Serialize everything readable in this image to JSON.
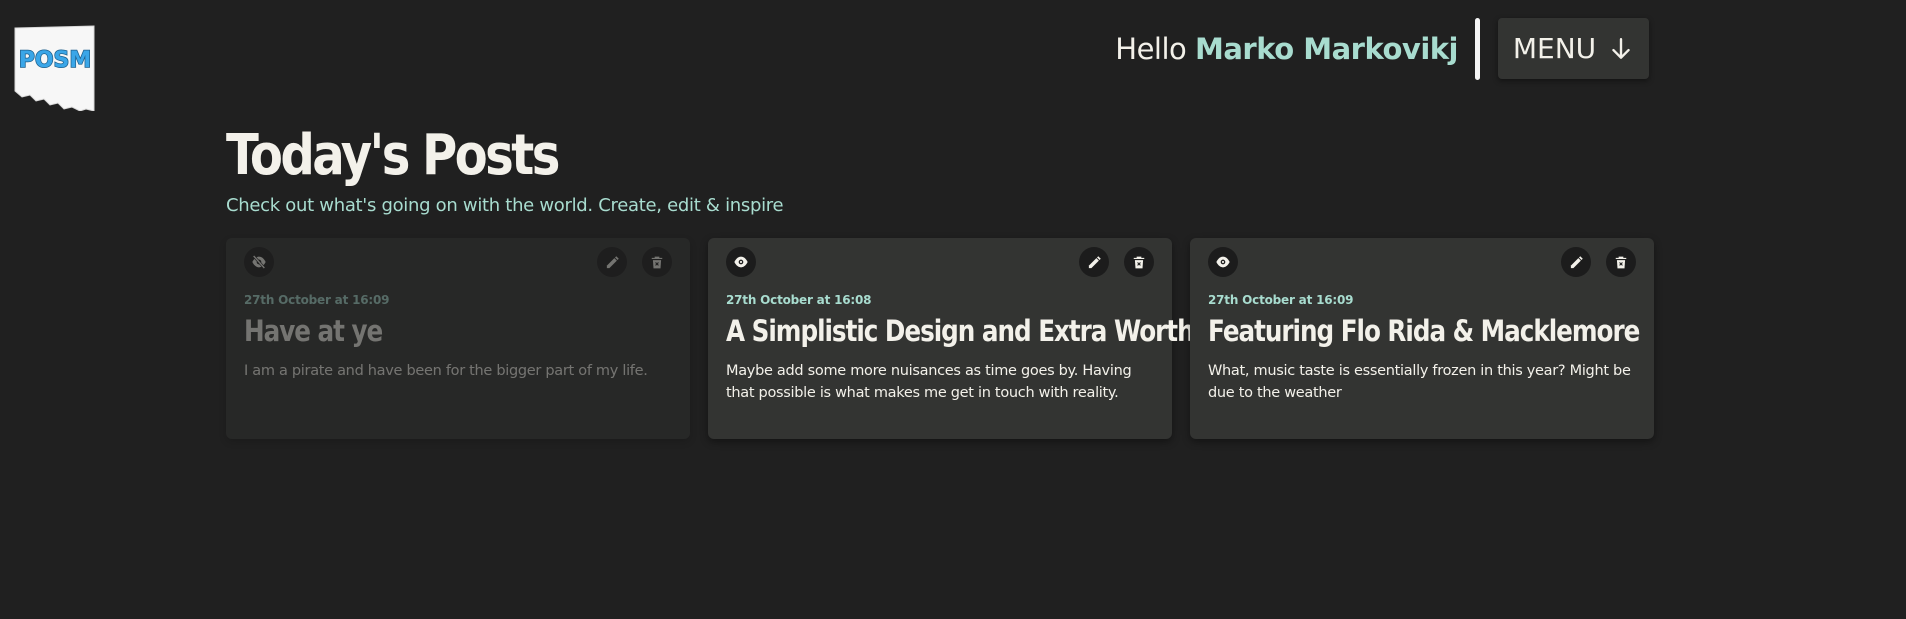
{
  "app": {
    "logo_text": "POSM"
  },
  "header": {
    "greeting": "Hello",
    "user_name": "Marko Markovikj",
    "menu_label": "MENU",
    "menu_icon": "arrow-down-icon"
  },
  "page": {
    "title": "Today's Posts",
    "subtitle": "Check out what's going on with the world. Create, edit & inspire"
  },
  "posts": [
    {
      "date": "27th October at 16:09",
      "title": "Have at ye",
      "body": "I am a pirate and have been for the bigger part of my life.",
      "visibility": "hidden",
      "visibility_icon": "eye-off-icon",
      "edit_icon": "pencil-icon",
      "delete_icon": "trash-icon"
    },
    {
      "date": "27th October at 16:08",
      "title": "A Simplistic Design and Extra Worth",
      "body": "Maybe add some more nuisances as time goes by. Having that possible is what makes me get in touch with reality.",
      "visibility": "visible",
      "visibility_icon": "eye-icon",
      "edit_icon": "pencil-icon",
      "delete_icon": "trash-icon"
    },
    {
      "date": "27th October at 16:09",
      "title": "Featuring Flo Rida & Macklemore",
      "body": "What, music taste is essentially frozen in this year? Might be due to the weather",
      "visibility": "visible",
      "visibility_icon": "eye-icon",
      "edit_icon": "pencil-icon",
      "delete_icon": "trash-icon"
    }
  ],
  "colors": {
    "background": "#202020",
    "card": "#333432",
    "accent": "#a8dccf",
    "text": "#f3f1ea",
    "logo_blue": "#3aa6e8"
  }
}
